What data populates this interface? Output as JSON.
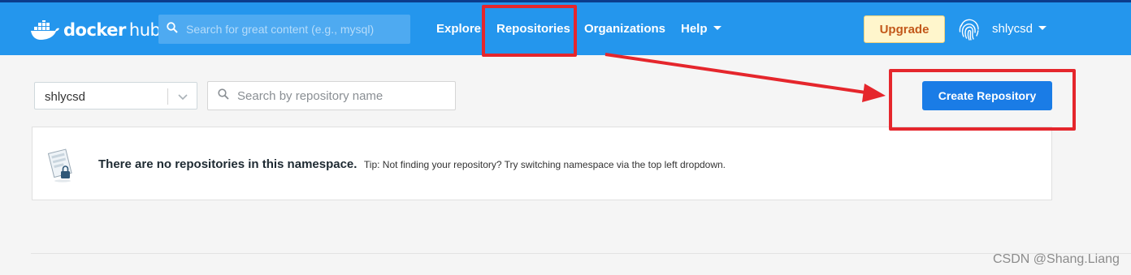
{
  "header": {
    "logo_name": "docker",
    "logo_product": "hub",
    "search_placeholder": "Search for great content (e.g., mysql)",
    "nav": {
      "explore": "Explore",
      "repositories": "Repositories",
      "organizations": "Organizations",
      "help": "Help"
    },
    "upgrade_label": "Upgrade",
    "username": "shlycsd"
  },
  "toolbar": {
    "namespace_value": "shlycsd",
    "repo_search_placeholder": "Search by repository name",
    "create_button_label": "Create Repository"
  },
  "empty_state": {
    "message": "There are no repositories in this namespace.",
    "tip": "Tip: Not finding your repository? Try switching namespace via the top left dropdown."
  },
  "watermark": "CSDN @Shang.Liang",
  "colors": {
    "navbar": "#2496ed",
    "primary_button": "#1a7ce6",
    "upgrade_bg": "#fff6cc",
    "upgrade_text": "#c2581a",
    "annotation_red": "#e5262c"
  },
  "icons": {
    "logo": "docker-whale-icon",
    "search": "search-icon",
    "avatar": "fingerprint-icon",
    "empty_state": "locked-repository-icon"
  }
}
